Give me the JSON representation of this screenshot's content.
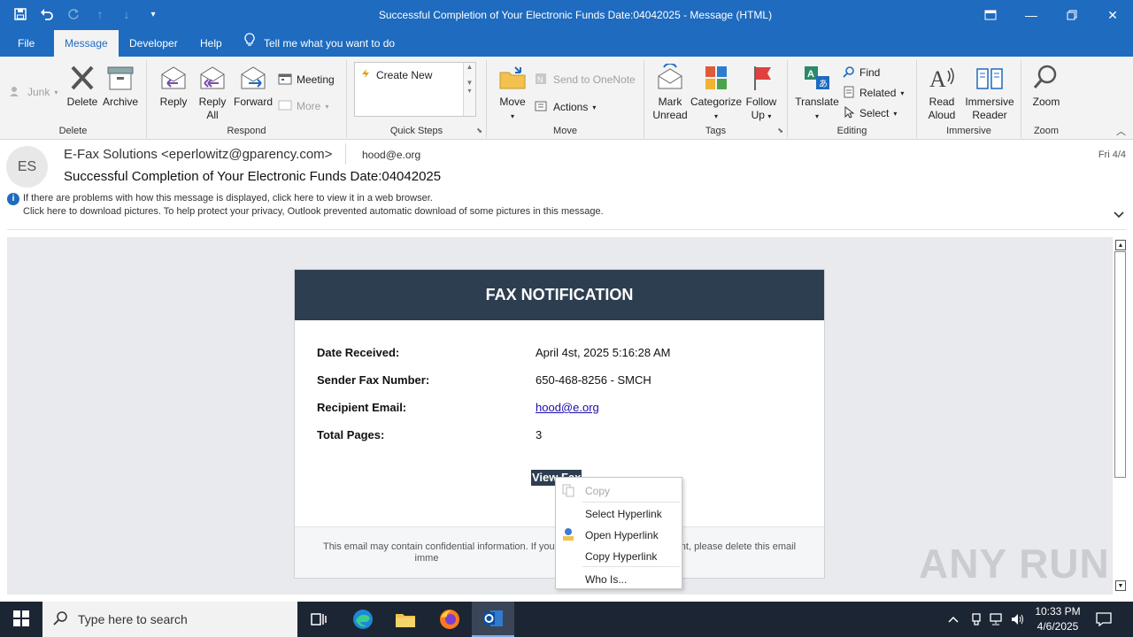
{
  "window": {
    "title": "Successful Completion of Your Electronic Funds Date:04042025  -  Message (HTML)",
    "quick_access": [
      "save-icon",
      "undo-icon",
      "redo-icon",
      "up-icon",
      "down-icon",
      "customize-icon"
    ]
  },
  "tabs": {
    "file": "File",
    "message": "Message",
    "developer": "Developer",
    "help": "Help",
    "tell_me": "Tell me what you want to do"
  },
  "ribbon": {
    "delete_group": {
      "label": "Delete",
      "junk": "Junk",
      "delete": "Delete",
      "archive": "Archive"
    },
    "respond_group": {
      "label": "Respond",
      "reply": "Reply",
      "reply_all_1": "Reply",
      "reply_all_2": "All",
      "forward": "Forward",
      "meeting": "Meeting",
      "more": "More"
    },
    "quick_steps": {
      "label": "Quick Steps",
      "create_new": "Create New"
    },
    "move_group": {
      "label": "Move",
      "move": "Move",
      "send_onenote": "Send to OneNote",
      "actions": "Actions"
    },
    "tags_group": {
      "label": "Tags",
      "mark_unread_1": "Mark",
      "mark_unread_2": "Unread",
      "categorize": "Categorize",
      "follow_up_1": "Follow",
      "follow_up_2": "Up"
    },
    "editing_group": {
      "label": "Editing",
      "translate": "Translate",
      "find": "Find",
      "related": "Related",
      "select": "Select"
    },
    "immersive_group": {
      "label": "Immersive",
      "read_aloud_1": "Read",
      "read_aloud_2": "Aloud",
      "immersive_reader_1": "Immersive",
      "immersive_reader_2": "Reader"
    },
    "zoom_group": {
      "label": "Zoom",
      "zoom": "Zoom"
    }
  },
  "message": {
    "avatar_initials": "ES",
    "from": "E-Fax Solutions <eperlowitz@gparency.com>",
    "to": "hood@e.org",
    "date": "Fri 4/4",
    "subject": "Successful Completion of Your Electronic Funds Date:04042025",
    "info_line1": "If there are problems with how this message is displayed, click here to view it in a web browser.",
    "info_line2": "Click here to download pictures. To help protect your privacy, Outlook prevented automatic download of some pictures in this message."
  },
  "email_body": {
    "header": "FAX NOTIFICATION",
    "rows": [
      {
        "key": "Date Received:",
        "value": "April 4st, 2025 5:16:28 AM"
      },
      {
        "key": "Sender Fax Number:",
        "value": "650-468-8256  - SMCH"
      },
      {
        "key": "Recipient Email:",
        "value": "hood@e.org"
      },
      {
        "key": "Total Pages:",
        "value": "3"
      }
    ],
    "view_fax": "View Fax",
    "footer_1": "This email may contain confidential information. If you",
    "footer_2": "nt, please delete this email",
    "footer_3": "imme"
  },
  "context_menu": {
    "copy": "Copy",
    "select_hyperlink": "Select Hyperlink",
    "open_hyperlink": "Open Hyperlink",
    "copy_hyperlink": "Copy Hyperlink",
    "who_is": "Who Is..."
  },
  "watermark": "ANY RUN",
  "taskbar": {
    "search_placeholder": "Type here to search",
    "time": "10:33 PM",
    "date": "4/6/2025"
  },
  "colors": {
    "accent": "#1e6bbf",
    "fax_header": "#2d3e50"
  }
}
